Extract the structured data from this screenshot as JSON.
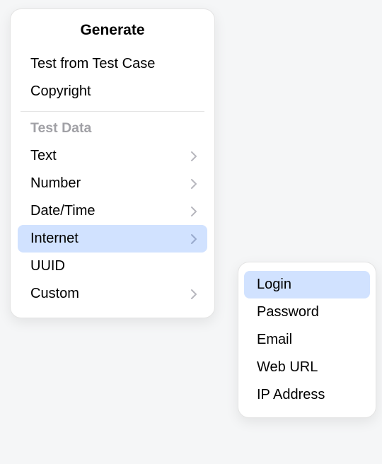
{
  "menu": {
    "title": "Generate",
    "top_items": [
      {
        "label": "Test from Test Case",
        "has_submenu": false,
        "highlighted": false,
        "key": "test-from-test-case"
      },
      {
        "label": "Copyright",
        "has_submenu": false,
        "highlighted": false,
        "key": "copyright"
      }
    ],
    "section_header": "Test Data",
    "data_items": [
      {
        "label": "Text",
        "has_submenu": true,
        "highlighted": false,
        "key": "text"
      },
      {
        "label": "Number",
        "has_submenu": true,
        "highlighted": false,
        "key": "number"
      },
      {
        "label": "Date/Time",
        "has_submenu": true,
        "highlighted": false,
        "key": "date-time"
      },
      {
        "label": "Internet",
        "has_submenu": true,
        "highlighted": true,
        "key": "internet"
      },
      {
        "label": "UUID",
        "has_submenu": false,
        "highlighted": false,
        "key": "uuid"
      },
      {
        "label": "Custom",
        "has_submenu": true,
        "highlighted": false,
        "key": "custom"
      }
    ]
  },
  "submenu": {
    "items": [
      {
        "label": "Login",
        "highlighted": true,
        "key": "login"
      },
      {
        "label": "Password",
        "highlighted": false,
        "key": "password"
      },
      {
        "label": "Email",
        "highlighted": false,
        "key": "email"
      },
      {
        "label": "Web URL",
        "highlighted": false,
        "key": "web-url"
      },
      {
        "label": "IP Address",
        "highlighted": false,
        "key": "ip-address"
      }
    ]
  }
}
